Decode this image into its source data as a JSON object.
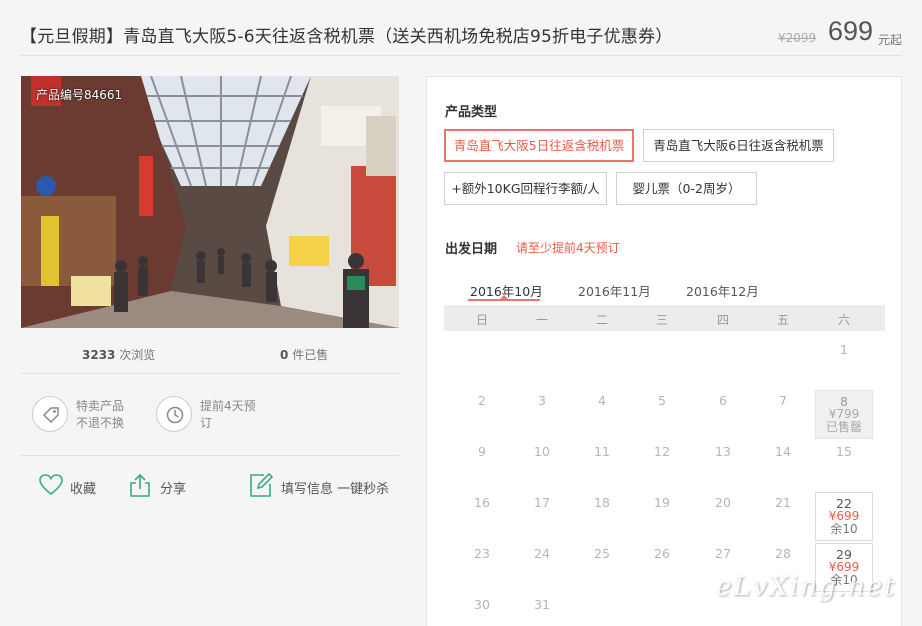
{
  "header": {
    "title": "【元旦假期】青岛直飞大阪5-6天往返含税机票（送关西机场免税店95折电子优惠券）",
    "original_price": "¥2099",
    "price": "699",
    "price_unit": "元起"
  },
  "gallery": {
    "product_number": "产品编号84661"
  },
  "stats": {
    "views_count": "3233",
    "views_label": "次浏览",
    "sold_count": "0",
    "sold_label": "件已售"
  },
  "features": [
    {
      "line1": "特卖产品",
      "line2": "不退不换",
      "icon": "tag-icon"
    },
    {
      "line1": "提前4天预",
      "line2": "订",
      "icon": "clock-icon"
    }
  ],
  "actions": {
    "favorite": "收藏",
    "share": "分享",
    "fill_info": "填写信息 一键秒杀"
  },
  "booking": {
    "type_label": "产品类型",
    "options": [
      "青岛直飞大阪5日往返含税机票",
      "青岛直飞大阪6日往返含税机票",
      "+额外10KG回程行李额/人",
      "婴儿票（0-2周岁）"
    ],
    "selected_option": 0,
    "date_label": "出发日期",
    "date_note": "请至少提前4天预订",
    "months": [
      "2016年10月",
      "2016年11月",
      "2016年12月"
    ],
    "active_month": 0,
    "weekdays": [
      "日",
      "一",
      "二",
      "三",
      "四",
      "五",
      "六"
    ],
    "calendar": {
      "day1": "1",
      "row2": [
        "2",
        "3",
        "4",
        "5",
        "6",
        "7"
      ],
      "sat8": {
        "day": "8",
        "price": "¥799",
        "status": "已售罄"
      },
      "row3": [
        "9",
        "10",
        "11",
        "12",
        "13",
        "14",
        "15"
      ],
      "row4": [
        "16",
        "17",
        "18",
        "19",
        "20",
        "21"
      ],
      "sat22": {
        "day": "22",
        "price": "¥699",
        "remain": "余10"
      },
      "row5": [
        "23",
        "24",
        "25",
        "26",
        "27",
        "28"
      ],
      "sat29": {
        "day": "29",
        "price": "¥699",
        "remain": "余10"
      },
      "row6": [
        "30",
        "31"
      ]
    }
  },
  "watermark": "eLvXing.net",
  "colors": {
    "accent": "#e85c4a",
    "icon_green": "#3aaa8a"
  }
}
